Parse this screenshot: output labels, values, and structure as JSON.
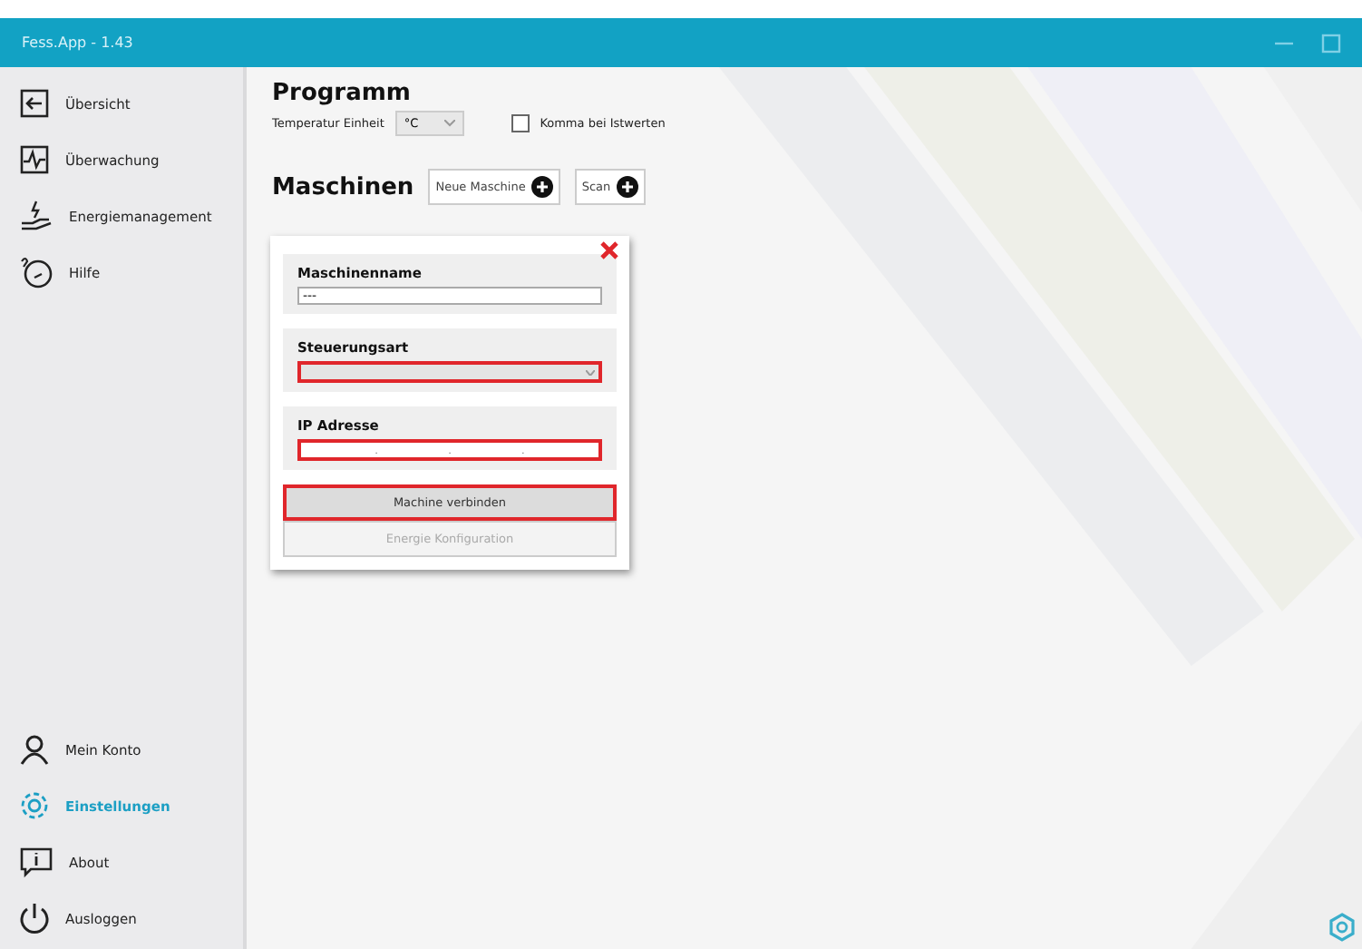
{
  "window": {
    "title": "Fess.App - 1.43"
  },
  "sidebar": {
    "items": [
      {
        "label": "Übersicht",
        "selected": false
      },
      {
        "label": "Überwachung",
        "selected": false
      },
      {
        "label": "Energiemanagement",
        "selected": false
      },
      {
        "label": "Hilfe",
        "selected": false
      }
    ],
    "bottom_items": [
      {
        "label": "Mein Konto",
        "selected": false
      },
      {
        "label": "Einstellungen",
        "selected": true
      },
      {
        "label": "About",
        "selected": false
      },
      {
        "label": "Ausloggen",
        "selected": false
      }
    ]
  },
  "program": {
    "heading": "Programm",
    "temperature_label": "Temperatur Einheit",
    "temperature_unit": "°C",
    "comma_label": "Komma bei Istwerten",
    "comma_checked": false
  },
  "machines": {
    "heading": "Maschinen",
    "new_button": "Neue Maschine",
    "scan_button": "Scan"
  },
  "machine_card": {
    "fields": [
      {
        "kind": "text",
        "label": "Maschinenname",
        "value": "---",
        "invalid": false
      },
      {
        "kind": "select",
        "label": "Steuerungsart",
        "invalid": true
      },
      {
        "kind": "ip",
        "label": "IP Adresse",
        "segments": [
          ".",
          ".",
          "."
        ],
        "invalid": true
      }
    ],
    "buttons": [
      {
        "label": "Machine verbinden",
        "highlighted": true,
        "disabled": false
      },
      {
        "label": "Energie Konfiguration",
        "highlighted": false,
        "disabled": true
      }
    ]
  }
}
